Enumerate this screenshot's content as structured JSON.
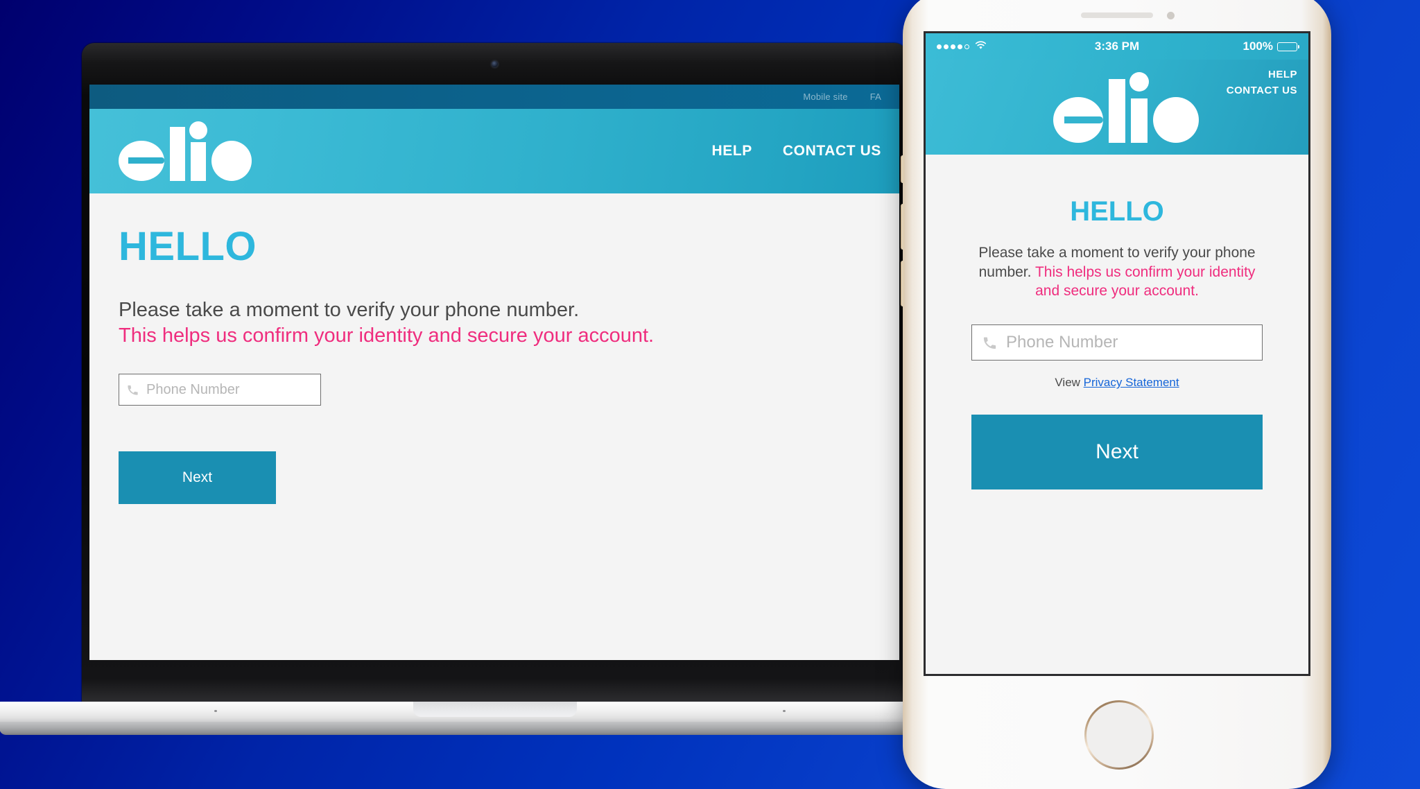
{
  "background": {
    "gradient_from": "#00006e",
    "gradient_to": "#0d4ad8"
  },
  "brand": {
    "name": "elio",
    "logo_color": "#ffffff",
    "header_teal": "#2fb0cc",
    "accent_cyan": "#2eb7dd",
    "accent_pink": "#ef2d7e",
    "button_teal": "#1a8fb2",
    "link_blue": "#1565d8"
  },
  "desktop": {
    "utility_bar": {
      "links": [
        "Mobile site",
        "FA"
      ]
    },
    "header": {
      "logo": "elio",
      "nav": [
        "HELP",
        "CONTACT US"
      ]
    },
    "page": {
      "heading": "HELLO",
      "body_line1": "Please take a moment to verify your phone number.",
      "body_line2": "This helps us confirm your identity and secure your account.",
      "phone_input": {
        "icon": "phone-icon",
        "placeholder": "Phone Number",
        "value": ""
      },
      "next_button": "Next"
    }
  },
  "mobile": {
    "statusbar": {
      "signal_dots_filled": 4,
      "signal_dots_total": 5,
      "wifi": "wifi-icon",
      "time": "3:36 PM",
      "battery_percent": "100%"
    },
    "header": {
      "logo": "elio",
      "nav": [
        "HELP",
        "CONTACT US"
      ]
    },
    "page": {
      "heading": "HELLO",
      "body_plain": "Please take a moment to verify your phone number. ",
      "body_highlight": "This helps us confirm your identity and secure your account.",
      "phone_input": {
        "icon": "phone-icon",
        "placeholder": "Phone Number",
        "value": ""
      },
      "privacy_prefix": "View ",
      "privacy_link": "Privacy Statement",
      "next_button": "Next"
    }
  }
}
